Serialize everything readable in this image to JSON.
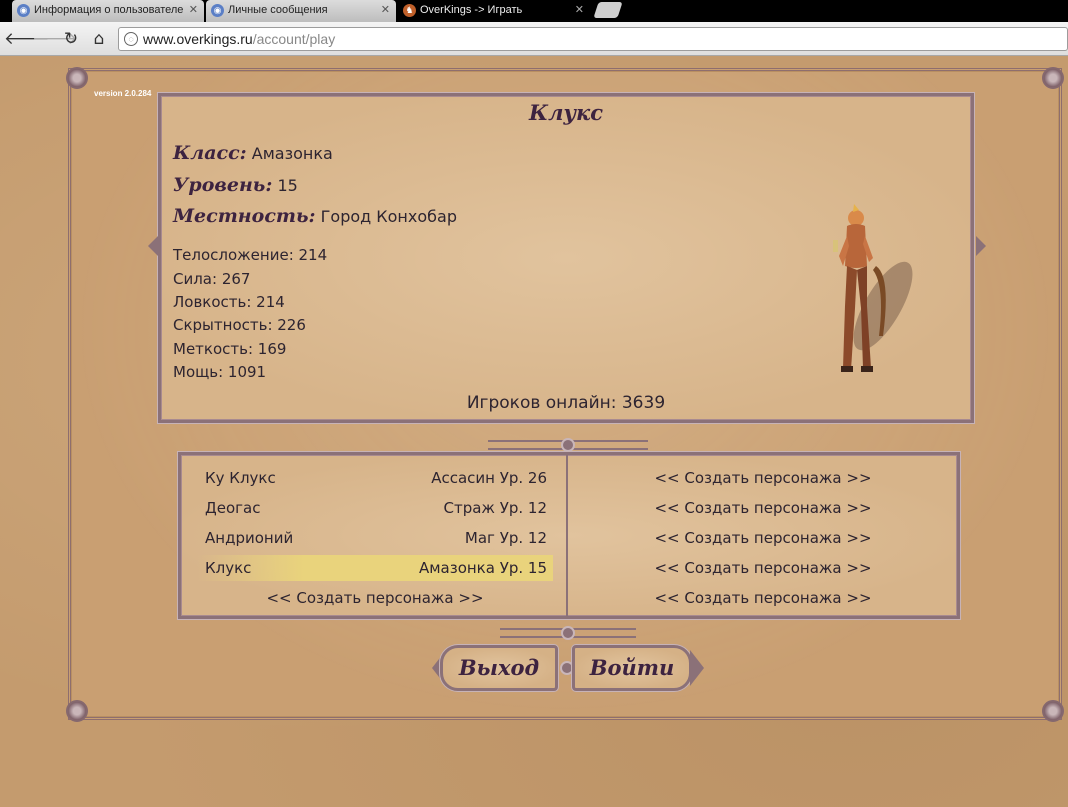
{
  "browser": {
    "tabs": [
      {
        "label": "Информация о пользователе",
        "close": "✕",
        "icon": "site-icon"
      },
      {
        "label": "Личные сообщения",
        "close": "✕",
        "icon": "site-icon"
      },
      {
        "label": "OverKings -> Играть",
        "close": "✕",
        "icon": "game-icon"
      }
    ],
    "url_host": "www.overkings.ru",
    "url_path": "/account/play"
  },
  "version": "version 2.0.284",
  "character": {
    "name": "Клукс",
    "class_label": "Класс:",
    "class_value": "Амазонка",
    "level_label": "Уровень:",
    "level_value": "15",
    "location_label": "Местность:",
    "location_value": "Город Конхобар",
    "stats": [
      "Телосложение: 214",
      "Сила: 267",
      "Ловкость: 214",
      "Скрытность: 226",
      "Меткость: 169",
      "Мощь: 1091"
    ]
  },
  "online": "Игроков онлайн: 3639",
  "characters": [
    {
      "name": "Ку Клукс",
      "class": "Ассасин Ур. 26",
      "selected": false
    },
    {
      "name": "Деогас",
      "class": "Страж Ур. 12",
      "selected": false
    },
    {
      "name": "Андрионий",
      "class": "Маг Ур. 12",
      "selected": false
    },
    {
      "name": "Клукс",
      "class": "Амазонка Ур. 15",
      "selected": true
    }
  ],
  "create_label": "<< Создать персонажа >>",
  "buttons": {
    "exit": "Выход",
    "enter": "Войти"
  },
  "colors": {
    "accent": "#3d2340",
    "frame": "#8b7178",
    "selection": "#e9d37c",
    "parchment": "#d7b48a"
  }
}
